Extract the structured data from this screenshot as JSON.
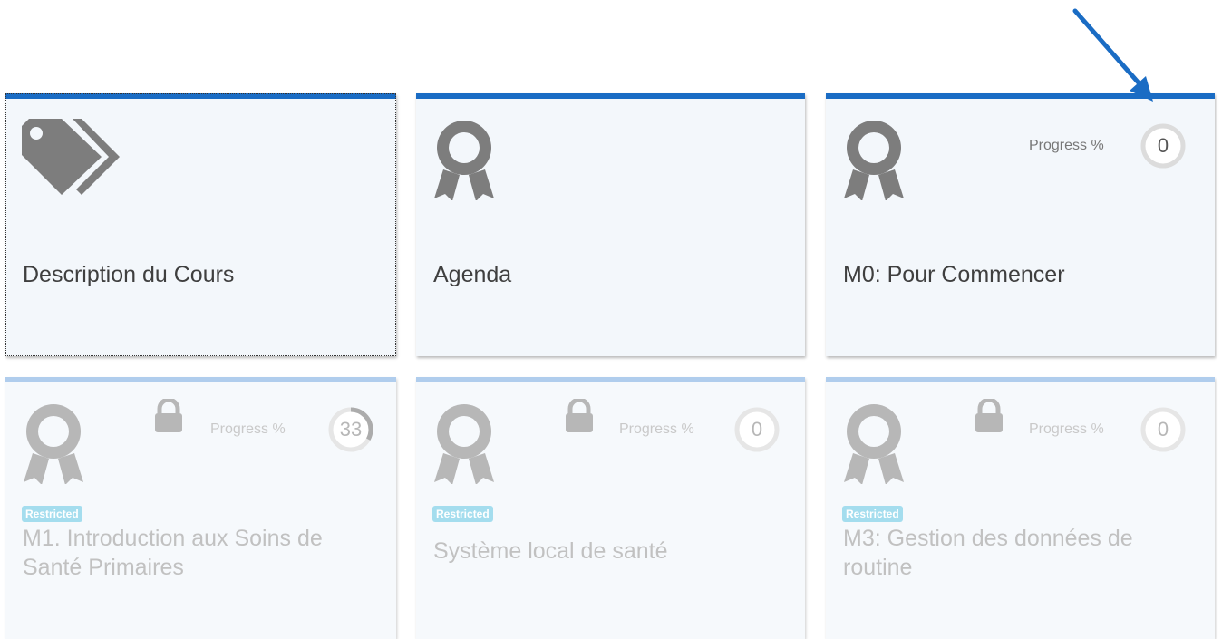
{
  "tiles": [
    {
      "title": "Description du Cours",
      "icon": "tag-icon"
    },
    {
      "title": "Agenda",
      "icon": "award-icon"
    },
    {
      "title": "M0: Pour Commencer",
      "icon": "award-icon",
      "progress_label": "Progress %",
      "progress": "0",
      "progress_fraction": 0
    },
    {
      "title": "M1. Introduction aux Soins de Santé Primaires",
      "icon": "award-icon",
      "locked": true,
      "badge": "Restricted",
      "progress_label": "Progress %",
      "progress": "33",
      "progress_fraction": 0.33
    },
    {
      "title": "Système local de santé",
      "icon": "award-icon",
      "locked": true,
      "badge": "Restricted",
      "progress_label": "Progress %",
      "progress": "0",
      "progress_fraction": 0
    },
    {
      "title": "M3: Gestion des données de routine",
      "icon": "award-icon",
      "locked": true,
      "badge": "Restricted",
      "progress_label": "Progress %",
      "progress": "0",
      "progress_fraction": 0
    }
  ],
  "colors": {
    "tile_border_active": "#1a6cc4",
    "tile_border_restricted": "#8fb8e6",
    "badge_bg": "#7ed0e8",
    "annotation_arrow": "#1a6cc4"
  }
}
